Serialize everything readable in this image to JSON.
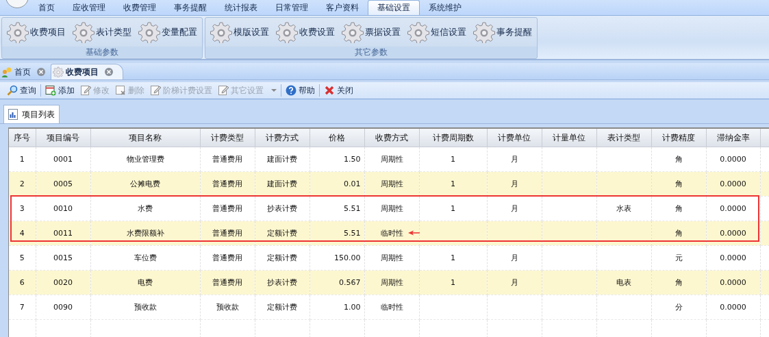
{
  "menu_tabs": [
    {
      "label": "首页",
      "selected": false
    },
    {
      "label": "应收管理",
      "selected": false
    },
    {
      "label": "收费管理",
      "selected": false
    },
    {
      "label": "事务提醒",
      "selected": false
    },
    {
      "label": "统计报表",
      "selected": false
    },
    {
      "label": "日常管理",
      "selected": false
    },
    {
      "label": "客户资料",
      "selected": false
    },
    {
      "label": "基础设置",
      "selected": true
    },
    {
      "label": "系统维护",
      "selected": false
    }
  ],
  "ribbon_groups": [
    {
      "title": "基础参数",
      "buttons": [
        "收费项目",
        "表计类型",
        "变量配置"
      ]
    },
    {
      "title": "其它参数",
      "buttons": [
        "模版设置",
        "收费设置",
        "票据设置",
        "短信设置",
        "事务提醒"
      ]
    }
  ],
  "doc_tabs": [
    {
      "label": "首页",
      "selected": false
    },
    {
      "label": "收费项目",
      "selected": true
    }
  ],
  "toolbar": [
    {
      "label": "查询",
      "disabled": false,
      "dropdown": false
    },
    {
      "label": "添加",
      "disabled": false,
      "dropdown": false
    },
    {
      "label": "修改",
      "disabled": true,
      "dropdown": false
    },
    {
      "label": "删除",
      "disabled": true,
      "dropdown": false
    },
    {
      "label": "阶梯计费设置",
      "disabled": true,
      "dropdown": false
    },
    {
      "label": "其它设置",
      "disabled": true,
      "dropdown": true
    },
    {
      "label": "帮助",
      "disabled": false,
      "dropdown": false
    },
    {
      "label": "关闭",
      "disabled": false,
      "dropdown": false
    }
  ],
  "panel_tab": {
    "label": "项目列表"
  },
  "table": {
    "columns": [
      "序号",
      "项目编号",
      "项目名称",
      "计费类型",
      "计费方式",
      "价格",
      "收费方式",
      "计费周期数",
      "计费单位",
      "计量单位",
      "表计类型",
      "计费精度",
      "滞纳金率"
    ],
    "rows": [
      {
        "cells": [
          "1",
          "0001",
          "物业管理费",
          "普通费用",
          "建面计费",
          "1.50",
          "周期性",
          "1",
          "月",
          "",
          "",
          "角",
          "0.0000"
        ],
        "marked": false,
        "arrow": false
      },
      {
        "cells": [
          "2",
          "0005",
          "公摊电费",
          "普通费用",
          "建面计费",
          "0.01",
          "周期性",
          "1",
          "月",
          "",
          "",
          "角",
          "0.0000"
        ],
        "marked": false,
        "arrow": false
      },
      {
        "cells": [
          "3",
          "0010",
          "水费",
          "普通费用",
          "抄表计费",
          "5.51",
          "周期性",
          "1",
          "月",
          "",
          "水表",
          "角",
          "0.0000"
        ],
        "marked": true,
        "arrow": false
      },
      {
        "cells": [
          "4",
          "0011",
          "水费限额补",
          "普通费用",
          "定额计费",
          "5.51",
          "临时性",
          "",
          "",
          "",
          "",
          "角",
          "0.0000"
        ],
        "marked": true,
        "arrow": true
      },
      {
        "cells": [
          "5",
          "0015",
          "车位费",
          "普通费用",
          "定额计费",
          "150.00",
          "周期性",
          "1",
          "月",
          "",
          "",
          "元",
          "0.0000"
        ],
        "marked": false,
        "arrow": false
      },
      {
        "cells": [
          "6",
          "0020",
          "电费",
          "普通费用",
          "抄表计费",
          "0.567",
          "周期性",
          "1",
          "月",
          "",
          "电表",
          "角",
          "0.0000"
        ],
        "marked": false,
        "arrow": false
      },
      {
        "cells": [
          "7",
          "0090",
          "预收款",
          "预收款",
          "定额计费",
          "1.00",
          "临时性",
          "",
          "",
          "",
          "",
          "分",
          "0.0000"
        ],
        "marked": false,
        "arrow": false
      }
    ]
  }
}
